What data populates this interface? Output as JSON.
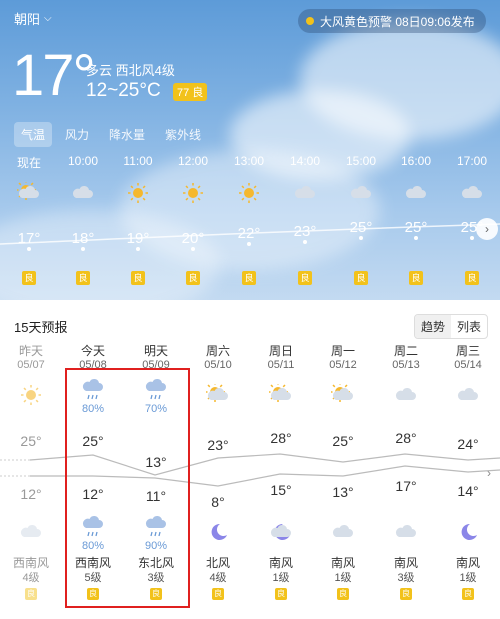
{
  "header": {
    "location": "朝阳",
    "alert_text": "大风黄色预警 08日09:06发布",
    "current_temp": "17°",
    "condition": "多云  西北风4级",
    "temp_range": "12~25°C",
    "aqi_badge": "77 良"
  },
  "tabs": [
    "气温",
    "风力",
    "降水量",
    "紫外线"
  ],
  "hourly": [
    {
      "time": "现在",
      "temp": "17°",
      "icon": "sun-cloud-icon",
      "aqi": "良"
    },
    {
      "time": "10:00",
      "temp": "18°",
      "icon": "cloud-icon",
      "aqi": "良"
    },
    {
      "time": "11:00",
      "temp": "19°",
      "icon": "sun-icon",
      "aqi": "良"
    },
    {
      "time": "12:00",
      "temp": "20°",
      "icon": "sun-icon",
      "aqi": "良"
    },
    {
      "time": "13:00",
      "temp": "22°",
      "icon": "sun-icon",
      "aqi": "良"
    },
    {
      "time": "14:00",
      "temp": "23°",
      "icon": "cloud-icon",
      "aqi": "良"
    },
    {
      "time": "15:00",
      "temp": "25°",
      "icon": "cloud-icon",
      "aqi": "良"
    },
    {
      "time": "16:00",
      "temp": "25°",
      "icon": "cloud-icon",
      "aqi": "良"
    },
    {
      "time": "17:00",
      "temp": "25°",
      "icon": "cloud-icon",
      "aqi": "良"
    }
  ],
  "forecast": {
    "title": "15天预报",
    "view_trend": "趋势",
    "view_list": "列表",
    "days": [
      {
        "name": "昨天",
        "date": "05/07",
        "day_icon": "sun-icon",
        "precip_day": "",
        "high": "25°",
        "low": "12°",
        "night_icon": "cloud-icon",
        "precip_night": "",
        "wind_dir": "西南风",
        "wind_level": "4级",
        "aqi": "良",
        "past": true
      },
      {
        "name": "今天",
        "date": "05/08",
        "day_icon": "rain-cloud-icon",
        "precip_day": "80%",
        "high": "25°",
        "low": "12°",
        "night_icon": "rain-cloud-icon",
        "precip_night": "80%",
        "wind_dir": "西南风",
        "wind_level": "5级",
        "aqi": "良",
        "past": false
      },
      {
        "name": "明天",
        "date": "05/09",
        "day_icon": "rain-cloud-icon",
        "precip_day": "70%",
        "high": "13°",
        "low": "11°",
        "night_icon": "rain-cloud-icon",
        "precip_night": "90%",
        "wind_dir": "东北风",
        "wind_level": "3级",
        "aqi": "良",
        "past": false
      },
      {
        "name": "周六",
        "date": "05/10",
        "day_icon": "sun-cloud-icon",
        "precip_day": "",
        "high": "23°",
        "low": "8°",
        "night_icon": "moon-icon",
        "precip_night": "",
        "wind_dir": "北风",
        "wind_level": "4级",
        "aqi": "良",
        "past": false
      },
      {
        "name": "周日",
        "date": "05/11",
        "day_icon": "sun-cloud-icon",
        "precip_day": "",
        "high": "28°",
        "low": "15°",
        "night_icon": "moon-cloud-icon",
        "precip_night": "",
        "wind_dir": "南风",
        "wind_level": "1级",
        "aqi": "良",
        "past": false
      },
      {
        "name": "周一",
        "date": "05/12",
        "day_icon": "sun-cloud-icon",
        "precip_day": "",
        "high": "25°",
        "low": "13°",
        "night_icon": "cloud-icon",
        "precip_night": "",
        "wind_dir": "南风",
        "wind_level": "1级",
        "aqi": "良",
        "past": false
      },
      {
        "name": "周二",
        "date": "05/13",
        "day_icon": "cloud-icon",
        "precip_day": "",
        "high": "28°",
        "low": "17°",
        "night_icon": "cloud-icon",
        "precip_night": "",
        "wind_dir": "南风",
        "wind_level": "3级",
        "aqi": "良",
        "past": false
      },
      {
        "name": "周三",
        "date": "05/14",
        "day_icon": "cloud-icon",
        "precip_day": "",
        "high": "24°",
        "low": "14°",
        "night_icon": "moon-icon",
        "precip_night": "",
        "wind_dir": "南风",
        "wind_level": "1级",
        "aqi": "良",
        "past": false
      }
    ]
  },
  "colors": {
    "aqi_good": "#f2c21b",
    "highlight": "#e0201f",
    "sky_top": "#5d9bd8"
  }
}
